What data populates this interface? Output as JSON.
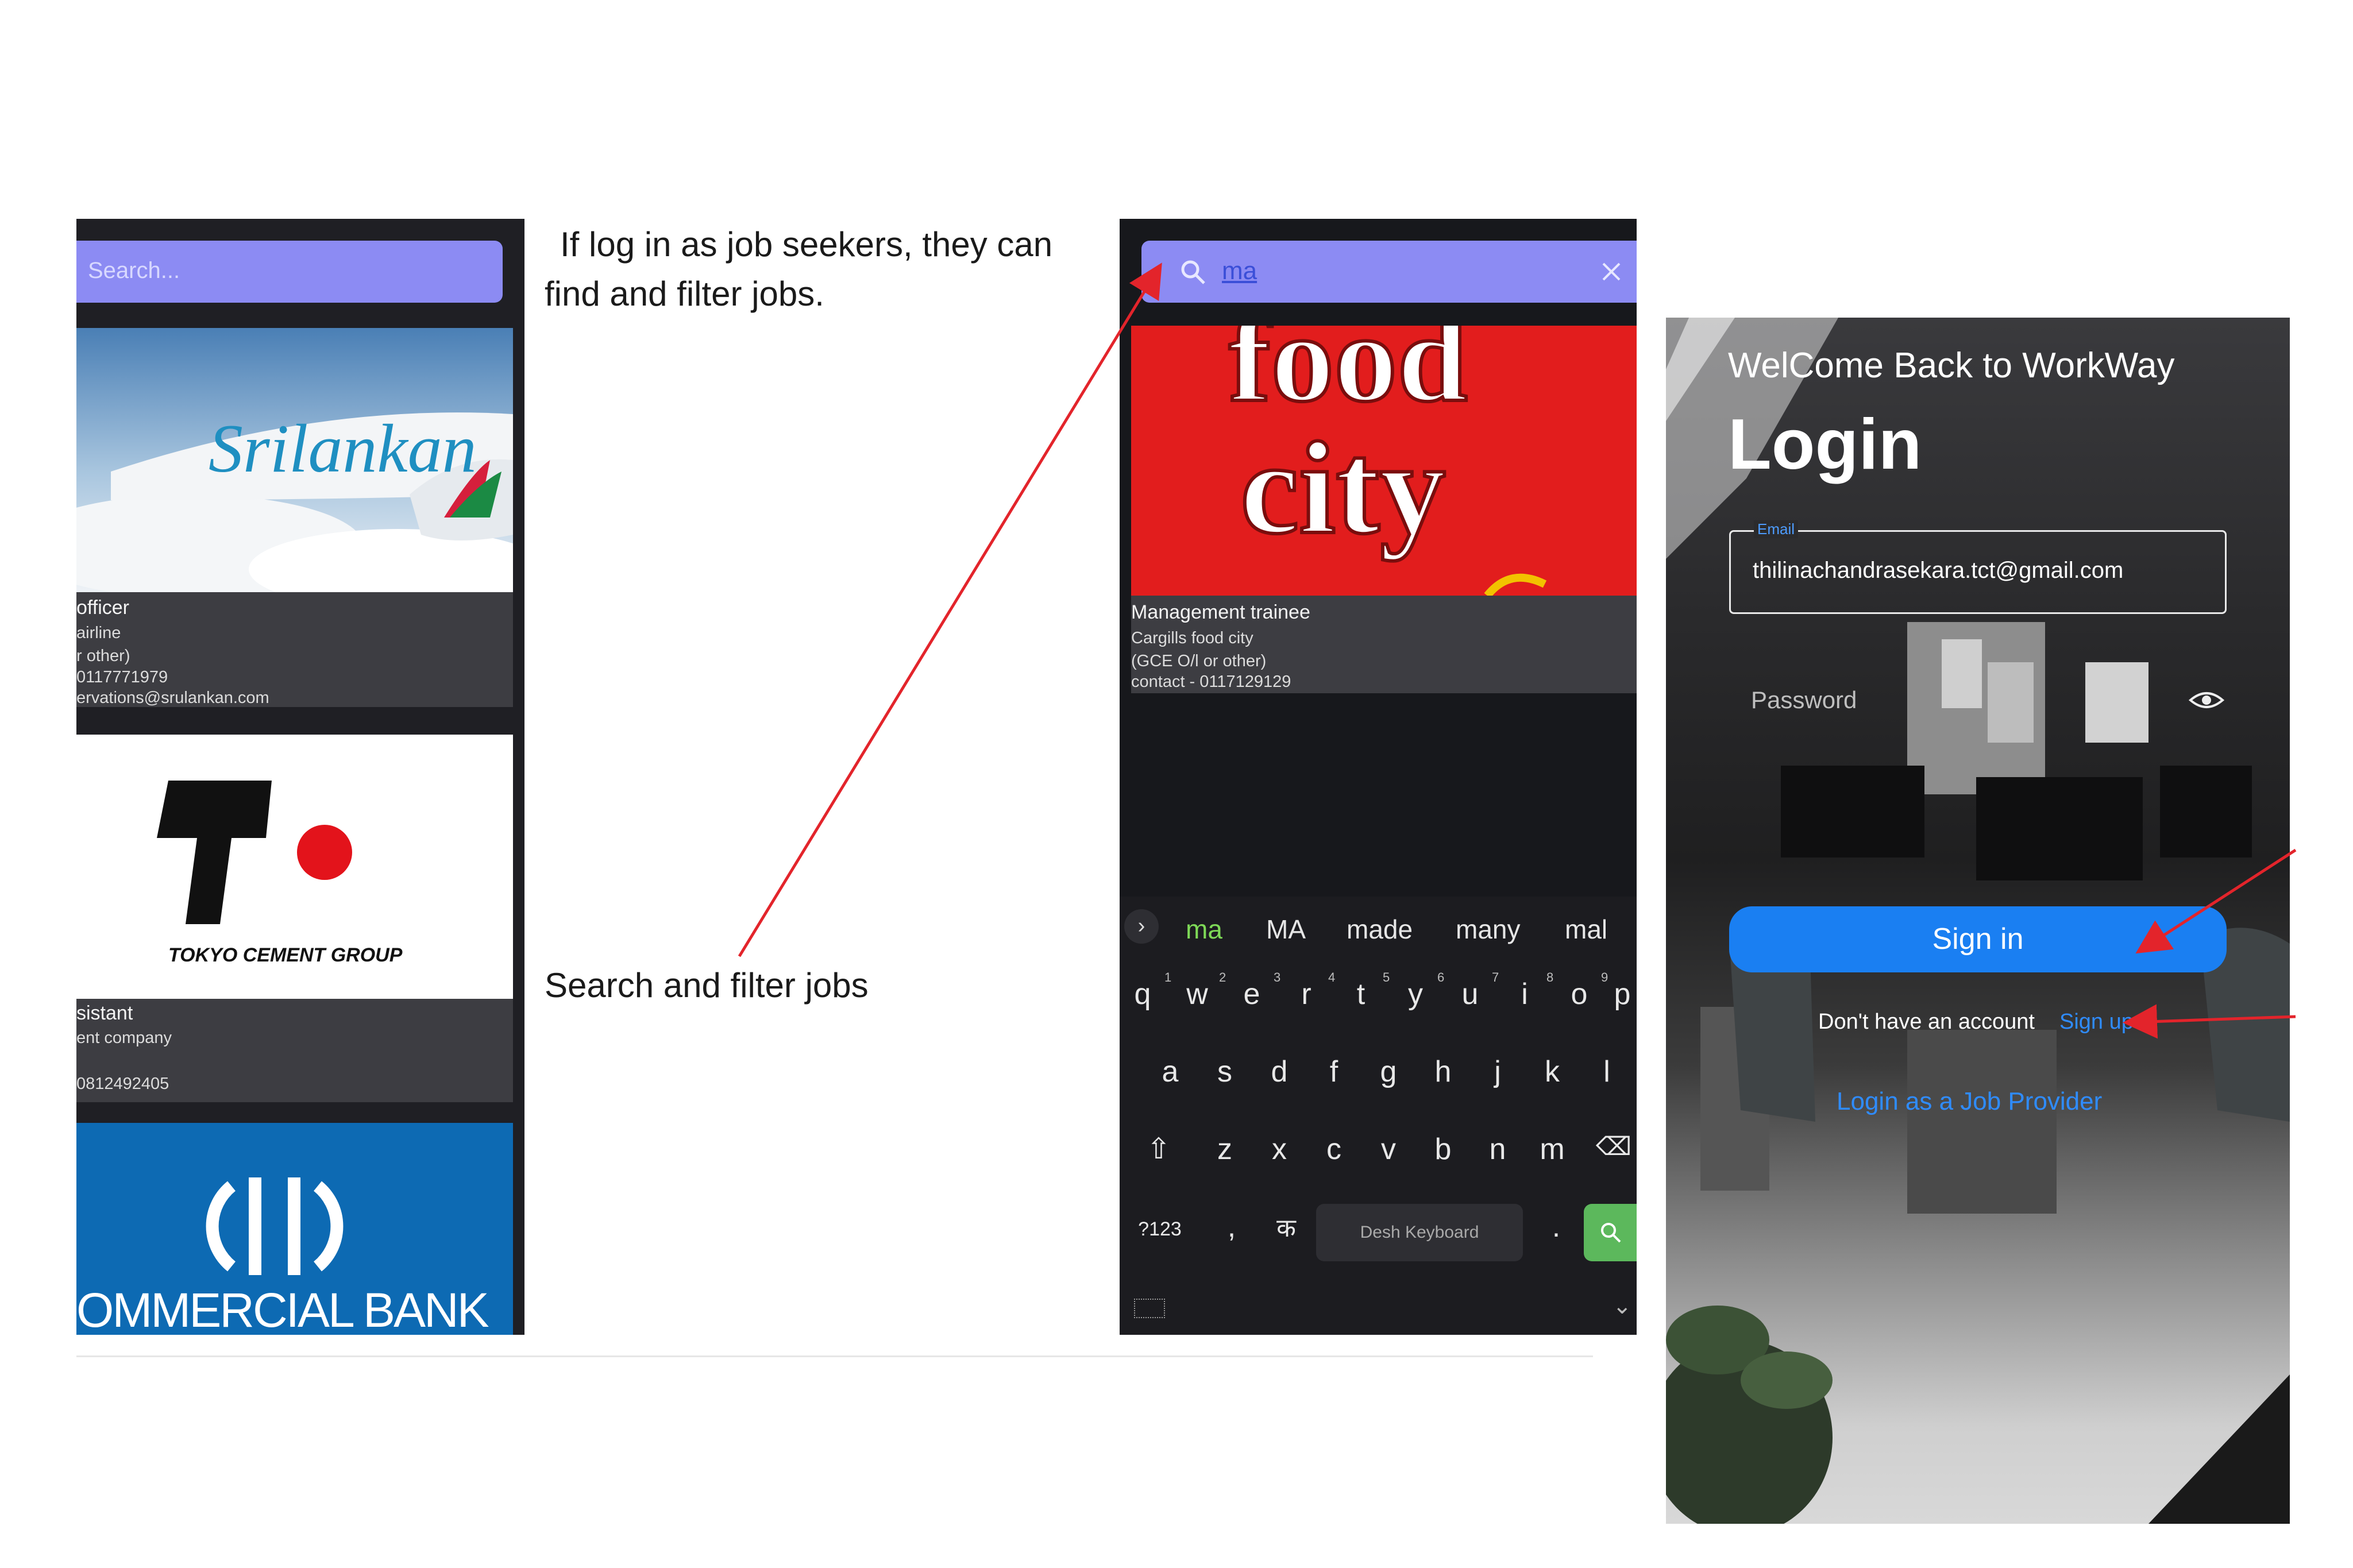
{
  "annotations": {
    "line1": "If log in as job seekers, they can",
    "line2": "find and filter jobs.",
    "search_filter": "Search and filter jobs"
  },
  "job_list": {
    "search_placeholder": "Search...",
    "cards": [
      {
        "image_text": "Srilankan",
        "title": "officer",
        "lines": [
          "airline",
          "r other)",
          "0117771979",
          "ervations@srulankan.com"
        ]
      },
      {
        "image_text": "TOKYO CEMENT GROUP",
        "title": "sistant",
        "lines": [
          "ent company",
          "",
          "0812492405"
        ]
      },
      {
        "image_text": "OMMERCIAL BANK"
      }
    ]
  },
  "search_screen": {
    "query": "ma",
    "result": {
      "image_text_1": "food",
      "image_text_2": "city",
      "title": "Management trainee",
      "lines": [
        "Cargills food city",
        "(GCE O/l or other)",
        "contact - 0117129129"
      ]
    },
    "keyboard": {
      "suggestions": [
        "ma",
        "MA",
        "made",
        "many",
        "mal"
      ],
      "row1": [
        "q",
        "w",
        "e",
        "r",
        "t",
        "y",
        "u",
        "i",
        "o",
        "p"
      ],
      "row1_nums": [
        "1",
        "2",
        "3",
        "4",
        "5",
        "6",
        "7",
        "8",
        "9"
      ],
      "row2": [
        "a",
        "s",
        "d",
        "f",
        "g",
        "h",
        "j",
        "k",
        "l"
      ],
      "row3": [
        "z",
        "x",
        "c",
        "v",
        "b",
        "n",
        "m"
      ],
      "symbols_key": "?123",
      "comma": ",",
      "lang_key": "क",
      "space": "Desh Keyboard",
      "period": "."
    }
  },
  "login_screen": {
    "welcome": "WelCome Back to WorkWay",
    "title": "Login",
    "email_label": "Email",
    "email_value": "thilinachandrasekara.tct@gmail.com",
    "password_placeholder": "Password",
    "signin_label": "Sign in",
    "no_account": "Don't have an account",
    "signup_link": "Sign up",
    "provider_link": "Login as a Job Provider"
  },
  "colors": {
    "search_bar": "#8c8bf3",
    "signin_button": "#1a7ff2",
    "link": "#2f8cff",
    "annotation_arrow": "#e3242b",
    "suggestion_highlight": "#7ed957",
    "search_key": "#5cb85c"
  }
}
